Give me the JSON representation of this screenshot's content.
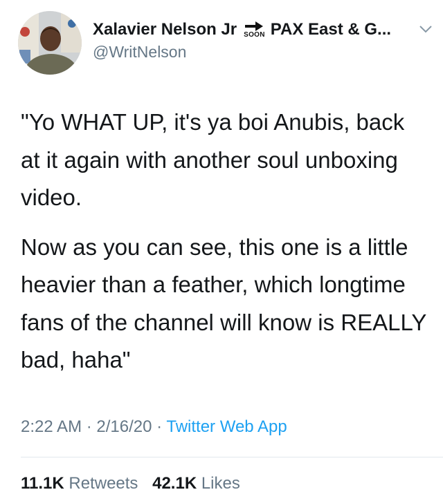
{
  "author": {
    "display_name_prefix": "Xalavier Nelson Jr",
    "emoji_label": "SOON",
    "display_name_suffix": "PAX East & G...",
    "handle": "@WritNelson"
  },
  "tweet": {
    "paragraphs": [
      "\"Yo WHAT UP, it's ya boi Anubis, back at it again with another soul unboxing video.",
      "Now as you can see, this one is a little heavier than a feather, which longtime fans of the channel will know is REALLY bad, haha\""
    ]
  },
  "meta": {
    "time": "2:22 AM",
    "separator": " · ",
    "date": "2/16/20",
    "source": "Twitter Web App"
  },
  "stats": {
    "retweets_count": "11.1K",
    "retweets_label": "Retweets",
    "likes_count": "42.1K",
    "likes_label": "Likes"
  },
  "icons": {
    "soon": "soon-arrow-icon",
    "chevron": "chevron-down-icon"
  }
}
